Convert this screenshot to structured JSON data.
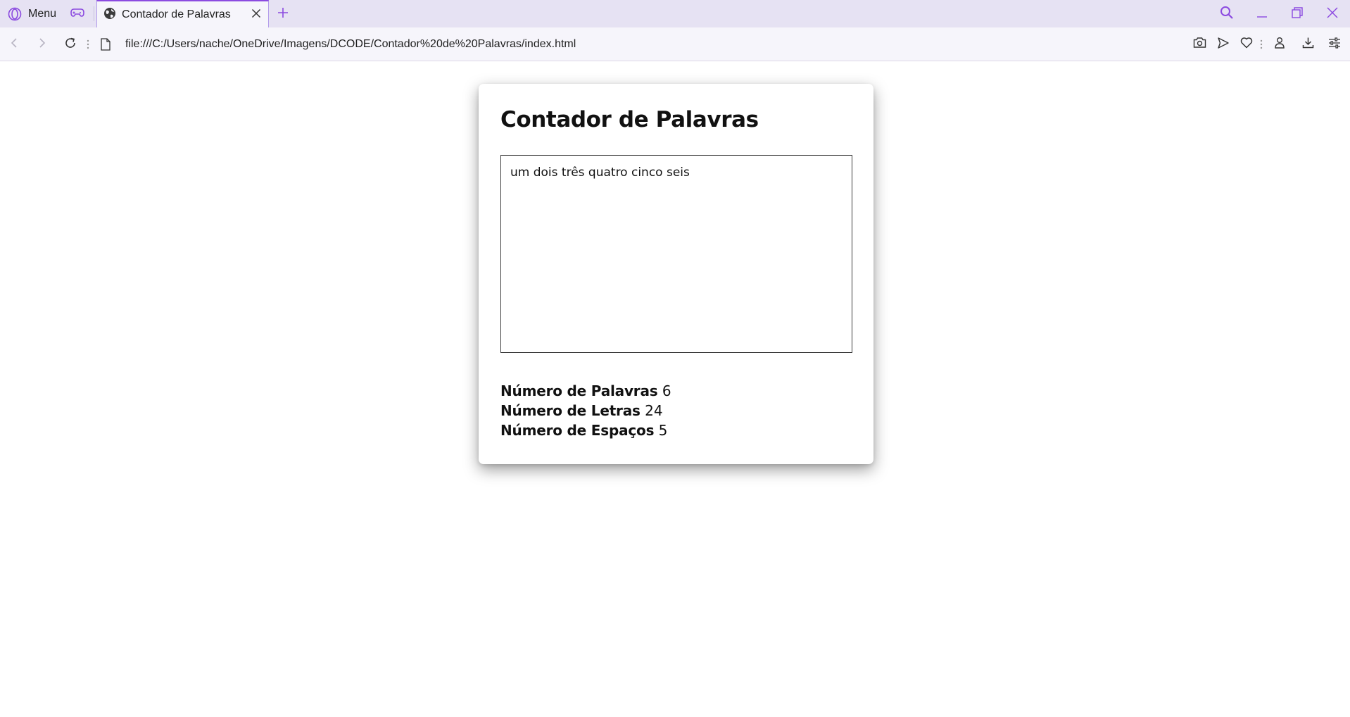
{
  "browser": {
    "menu_label": "Menu",
    "tab": {
      "title": "Contador de Palavras"
    },
    "address": {
      "url": "file:///C:/Users/nache/OneDrive/Imagens/DCODE/Contador%20de%20Palavras/index.html"
    },
    "accent_color": "#8b4ae0",
    "icons": {
      "menu": "opera-logo-icon",
      "gaming": "gamepad-icon",
      "favicon": "globe-icon",
      "close_tab": "close-icon",
      "new_tab": "plus-icon",
      "search": "search-icon",
      "minimize": "minimize-icon",
      "restore": "restore-icon",
      "close_window": "close-icon",
      "back": "back-arrow-icon",
      "forward": "forward-arrow-icon",
      "reload": "reload-icon",
      "page": "file-icon",
      "snapshot": "camera-icon",
      "send": "send-icon",
      "bookmark": "heart-icon",
      "profile": "user-icon",
      "download": "download-icon",
      "easy_setup": "settings-sliders-icon"
    }
  },
  "page": {
    "title": "Contador de Palavras",
    "textarea_value": "um dois três quatro cinco seis",
    "stats": [
      {
        "label": "Número de Palavras",
        "value": "6"
      },
      {
        "label": "Número de Letras",
        "value": "24"
      },
      {
        "label": "Número de Espaços",
        "value": "5"
      }
    ]
  }
}
